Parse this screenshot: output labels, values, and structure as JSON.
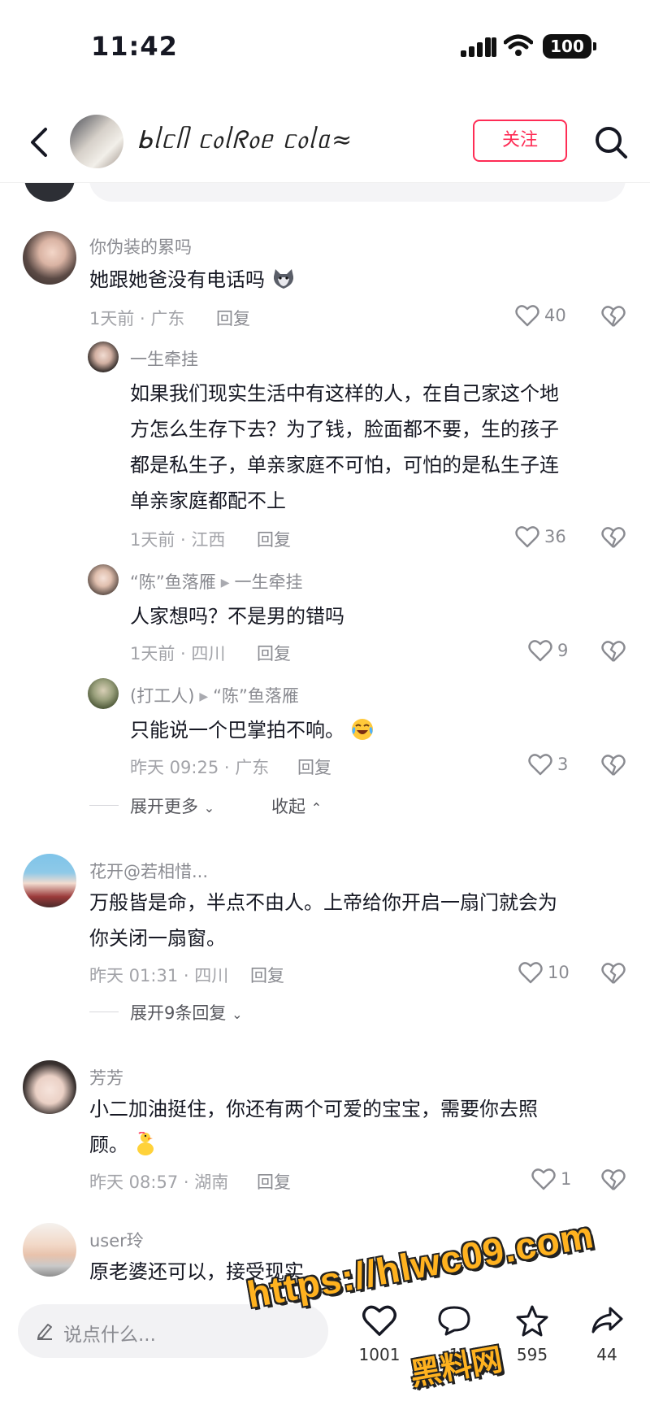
{
  "status_bar": {
    "time": "11:42",
    "battery": "100"
  },
  "nav": {
    "title": "ᖯᥣᥴᥥ ᥴ᥆ᥣᖇ᥆ᥱ ᥴ᥆ᥣᥲ≈",
    "follow_label": "关注"
  },
  "colors": {
    "accent": "#fe2c55",
    "muted": "#8a8b91",
    "watermark": "#ffb21f"
  },
  "comments": [
    {
      "user": "你伪装的累吗",
      "text": "她跟她爸没有电话吗",
      "emoji": "wolf-emoji",
      "meta": "1天前 · 广东",
      "reply": "回复",
      "likes": "40"
    },
    {
      "user": "一生牵挂",
      "text_lines": [
        "如果我们现实生活中有这样的人，在自己家这个地",
        "方怎么生存下去？为了钱，脸面都不要，生的孩子",
        "都是私生子，单亲家庭不可怕，可怕的是私生子连",
        "单亲家庭都配不上"
      ],
      "meta": "1天前 · 江西",
      "reply": "回复",
      "likes": "36"
    },
    {
      "user": "“陈”鱼落雁",
      "reply_to": "一生牵挂",
      "text": "人家想吗？不是男的错吗",
      "meta": "1天前 · 四川",
      "reply": "回复",
      "likes": "9"
    },
    {
      "user": "(打工人)",
      "reply_to": "“陈”鱼落雁",
      "text": "只能说一个巴掌拍不响。",
      "emoji": "laughing-crying-emoji",
      "meta": "昨天 09:25 · 广东",
      "reply": "回复",
      "likes": "3"
    },
    {
      "user": "花开@若相惜...",
      "text_lines": [
        "万般皆是命，半点不由人。上帝给你开启一扇门就会为",
        "你关闭一扇窗。"
      ],
      "meta": "昨天 01:31 · 四川",
      "reply": "回复",
      "likes": "10"
    },
    {
      "user": "芳芳",
      "text_lines": [
        "小二加油挺住，你还有两个可爱的宝宝，需要你去照",
        "顾。"
      ],
      "emoji": "duck-emoji",
      "meta": "昨天 08:57 · 湖南",
      "reply": "回复",
      "likes": "1"
    },
    {
      "user": "user玲",
      "text": "原老婆还可以，接受现实"
    }
  ],
  "expand": {
    "more": "展开更多",
    "collapse": "收起",
    "more_replies": "展开9条回复"
  },
  "bottom_bar": {
    "placeholder": "说点什么...",
    "likes": "1001",
    "comments": "1",
    "favorites": "595",
    "shares": "44"
  },
  "watermark": {
    "url": "https://hlwc09.com",
    "cn": "黑料网"
  }
}
